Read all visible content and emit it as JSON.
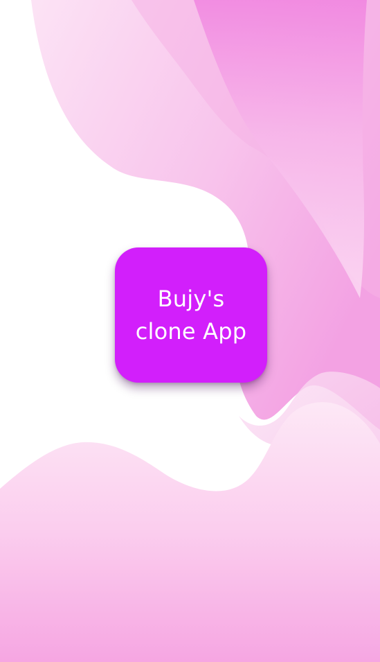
{
  "splash": {
    "logo_line_1": "Bujy's",
    "logo_line_2": "clone App"
  },
  "colors": {
    "logo_background": "#d21ffb",
    "logo_text": "#ffffff",
    "background": "#ffffff",
    "wave_light": "#fbdcf3",
    "wave_mid": "#f6b6e6",
    "wave_strong": "#ee6fdc"
  }
}
